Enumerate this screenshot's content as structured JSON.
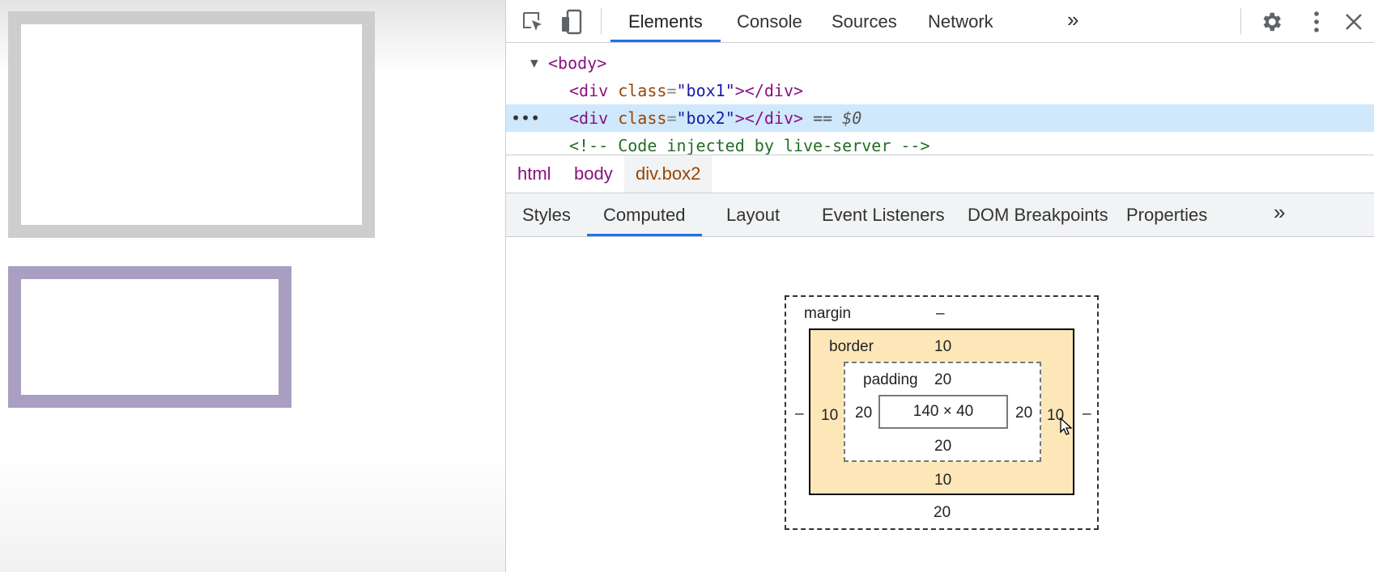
{
  "toolbar": {
    "icons": [
      "inspect-icon",
      "device-toolbar-icon",
      "gear-icon",
      "kebab-menu-icon",
      "close-icon"
    ],
    "tabs": [
      {
        "label": "Elements",
        "active": true
      },
      {
        "label": "Console",
        "active": false
      },
      {
        "label": "Sources",
        "active": false
      },
      {
        "label": "Network",
        "active": false
      }
    ],
    "more_label": "»"
  },
  "dom": {
    "body_tag": "<body>",
    "line1": {
      "open": "<div",
      "attr": "class",
      "value": "\"box1\"",
      "close": "></div>"
    },
    "line2": {
      "open": "<div",
      "attr": "class",
      "value": "\"box2\"",
      "close": "></div>",
      "suffix": "== $0"
    },
    "ellipsis": "•••",
    "comment": "<!-- Code injected by live-server -->"
  },
  "breadcrumbs": [
    "html",
    "body",
    "div.box2"
  ],
  "subtabs": [
    {
      "label": "Styles",
      "active": false
    },
    {
      "label": "Computed",
      "active": true
    },
    {
      "label": "Layout",
      "active": false
    },
    {
      "label": "Event Listeners",
      "active": false
    },
    {
      "label": "DOM Breakpoints",
      "active": false
    },
    {
      "label": "Properties",
      "active": false
    }
  ],
  "boxmodel": {
    "margin": {
      "label": "margin",
      "top": "–",
      "right": "–",
      "bottom": "20",
      "left": "–"
    },
    "border": {
      "label": "border",
      "top": "10",
      "right": "10",
      "bottom": "10",
      "left": "10"
    },
    "padding": {
      "label": "padding",
      "top": "20",
      "right": "20",
      "bottom": "20",
      "left": "20"
    },
    "content": "140 × 40"
  },
  "colors": {
    "accent": "#1a73e8",
    "selected_row": "#cfe8fc",
    "border_box": "#fde7b9",
    "box1_border": "#cdcdcd",
    "box2_border": "#a99fc2"
  }
}
